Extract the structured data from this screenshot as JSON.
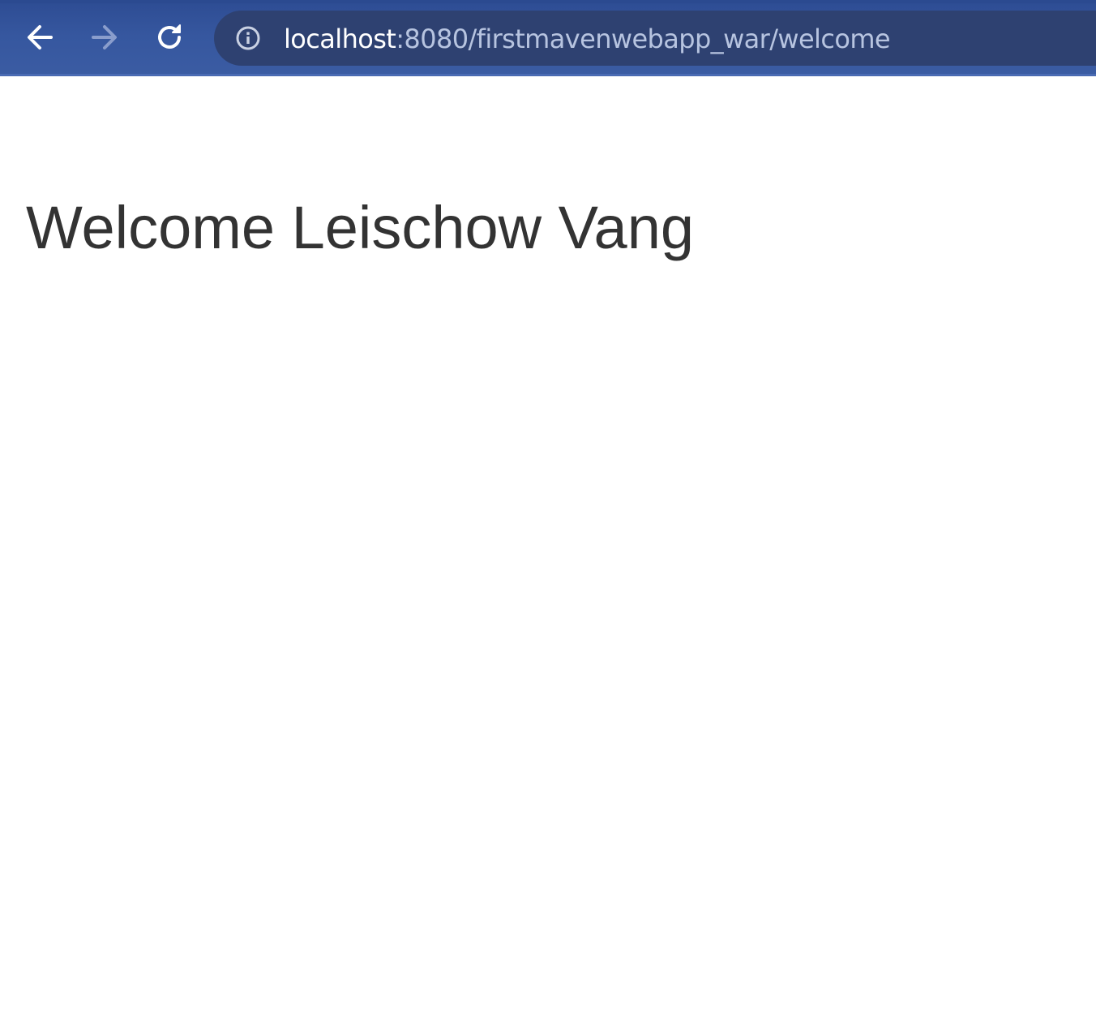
{
  "browser": {
    "toolbar_color": "#36579f",
    "omnibox_color": "#2e4171",
    "back_icon": "arrow-left-icon",
    "forward_icon": "arrow-right-icon",
    "forward_enabled": false,
    "reload_icon": "reload-icon",
    "site_info_icon": "info-circle-icon",
    "url_host": "localhost",
    "url_rest": ":8080/firstmavenwebapp_war/welcome"
  },
  "page": {
    "heading": "Welcome Leischow Vang",
    "text_color": "#333333",
    "background": "#ffffff"
  }
}
